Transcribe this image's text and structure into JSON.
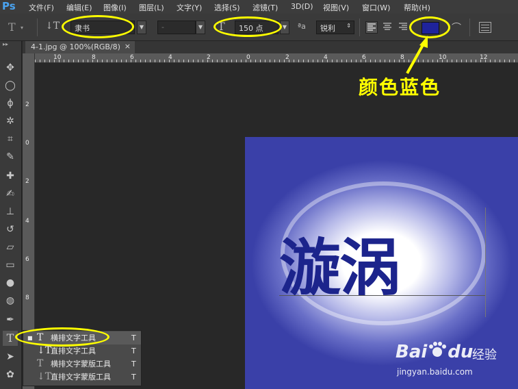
{
  "app": {
    "logo": "Ps"
  },
  "menu": [
    "文件(F)",
    "编辑(E)",
    "图像(I)",
    "图层(L)",
    "文字(Y)",
    "选择(S)",
    "滤镜(T)",
    "3D(D)",
    "视图(V)",
    "窗口(W)",
    "帮助(H)"
  ],
  "options": {
    "font_family": "隶书",
    "font_style": "-",
    "font_size": "150 点",
    "aa_icon_text": "ªa",
    "antialias": "锐利",
    "color": "#1f239c"
  },
  "document": {
    "tab_title": "4-1.jpg @ 100%(RGB/8)",
    "close": "×",
    "ruler_top": [
      "10",
      "8",
      "6",
      "4",
      "2",
      "0",
      "2",
      "4",
      "6",
      "8",
      "10",
      "12"
    ],
    "ruler_left": [
      "2",
      "0",
      "2",
      "4",
      "6",
      "8"
    ],
    "text": "漩涡"
  },
  "flyout": {
    "items": [
      {
        "label": "横排文字工具",
        "key": "T"
      },
      {
        "label": "直排文字工具",
        "key": "T"
      },
      {
        "label": "横排文字蒙版工具",
        "key": "T"
      },
      {
        "label": "直排文字蒙版工具",
        "key": "T"
      }
    ]
  },
  "annotation": "颜色蓝色",
  "watermark": {
    "brand": "Bai",
    "brand2": "du",
    "suffix": "经验",
    "url": "jingyan.baidu.com"
  },
  "colors": {
    "accent_yellow": "#ffff00",
    "text_blue": "#1c248c",
    "ps_blue": "#4aa3f0"
  }
}
